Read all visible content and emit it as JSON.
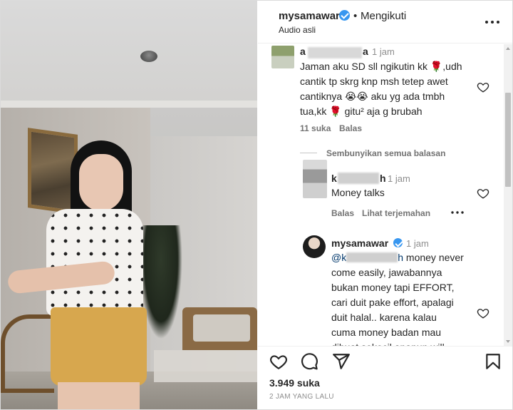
{
  "header": {
    "username": "mysamawar",
    "separator": "•",
    "follow_status": "Mengikuti",
    "audio": "Audio asli",
    "more_icon": "more-horizontal-icon"
  },
  "comments": [
    {
      "username_visible": "a",
      "username_tail": "a",
      "time": "1 jam",
      "lines": [
        "Jaman aku SD sll ngikutin kk 🌹,udh",
        "cantik tp skrg knp msh tetep awet",
        "cantiknya 😭😭 aku yg ada tmbh",
        "tua,kk 🌹 gitu² aja g brubah"
      ],
      "likes": "11 suka",
      "reply": "Balas"
    }
  ],
  "hide_replies": "Sembunyikan semua balasan",
  "replies": [
    {
      "username_prefix": "k",
      "username_suffix": "h",
      "time": "1 jam",
      "text": "Money talks",
      "reply": "Balas",
      "translate": "Lihat terjemahan"
    },
    {
      "username": "mysamawar",
      "time": "1 jam",
      "mention_prefix": "@k",
      "mention_suffix": "h",
      "first_line_rest": "money never",
      "lines": [
        "come easily, jawabannya",
        "bukan money tapi EFFORT,",
        "cari duit pake effort, apalagi",
        "duit halal.. karena kalau",
        "cuma money badan mau",
        "dibuat sekecil apapun will"
      ]
    }
  ],
  "footer": {
    "likes": "3.949 suka",
    "timestamp": "2 JAM YANG LALU"
  },
  "colors": {
    "verified_badge": "#3897f0",
    "text_primary": "#262626",
    "text_secondary": "#8e8e8e"
  }
}
